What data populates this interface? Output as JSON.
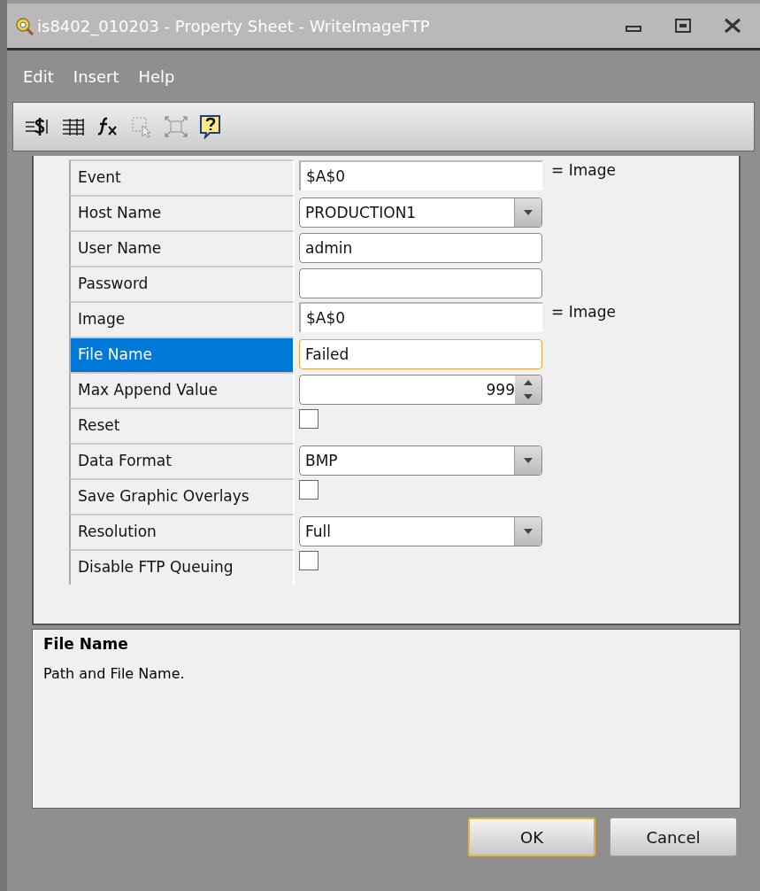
{
  "window": {
    "title": "is8402_010203 - Property Sheet - WriteImageFTP"
  },
  "menu": [
    "Edit",
    "Insert",
    "Help"
  ],
  "toolbar": [
    {
      "kind": "variable",
      "disabled": false
    },
    {
      "kind": "table",
      "disabled": false
    },
    {
      "kind": "function",
      "disabled": false
    },
    {
      "kind": "select",
      "disabled": true
    },
    {
      "kind": "expand",
      "disabled": true
    },
    {
      "kind": "help",
      "disabled": false
    }
  ],
  "properties": [
    {
      "label": "Event",
      "kind": "reference",
      "value": "$A$0",
      "note": "= Image",
      "selected": false
    },
    {
      "label": "Host Name",
      "kind": "dropdown",
      "value": "PRODUCTION1",
      "selected": false
    },
    {
      "label": "User Name",
      "kind": "text",
      "value": "admin",
      "selected": false
    },
    {
      "label": "Password",
      "kind": "text",
      "selected": false
    },
    {
      "label": "Image",
      "kind": "reference",
      "value": "$A$0",
      "note": "= Image",
      "selected": false
    },
    {
      "label": "File Name",
      "kind": "text",
      "value": "Failed",
      "selected": true
    },
    {
      "label": "Max Append Value",
      "kind": "spinner",
      "value": "999",
      "selected": false
    },
    {
      "label": "Reset",
      "kind": "checkbox",
      "checked": false,
      "selected": false
    },
    {
      "label": "Data Format",
      "kind": "dropdown",
      "value": "BMP",
      "selected": false
    },
    {
      "label": "Save Graphic Overlays",
      "kind": "checkbox",
      "checked": false,
      "selected": false
    },
    {
      "label": "Resolution",
      "kind": "dropdown",
      "value": "Full",
      "selected": false
    },
    {
      "label": "Disable FTP Queuing",
      "kind": "checkbox",
      "checked": false,
      "selected": false
    }
  ],
  "description": {
    "title": "File Name",
    "text": "Path and File Name."
  },
  "buttons": [
    {
      "label": "OK",
      "default": true
    },
    {
      "label": "Cancel",
      "default": false
    }
  ]
}
